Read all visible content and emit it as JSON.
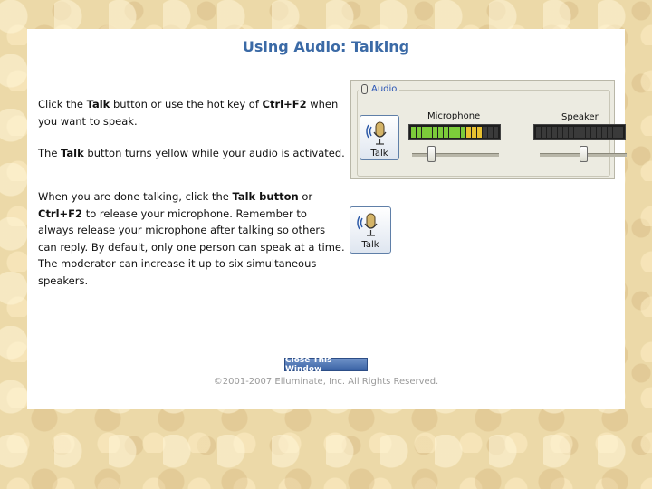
{
  "title": "Using Audio: Talking",
  "para1": {
    "t1": "Click the ",
    "b1": "Talk",
    "t2": " button or use the hot key of ",
    "b2": "Ctrl+F2",
    "t3": " when you want to speak."
  },
  "para2": {
    "t1": "The ",
    "b1": "Talk",
    "t2": " button turns yellow while your audio is activated."
  },
  "para3": {
    "t1": "When you are done talking, click the ",
    "b1": "Talk button",
    "t2": " or ",
    "b2": "Ctrl+F2",
    "t3": " to release your microphone. Remember to always release your microphone after talking so others can reply. By default, only one person can speak at a time. The moderator can increase it up to six simultaneous speakers."
  },
  "audio_panel": {
    "legend": "Audio",
    "talk_label": "Talk",
    "microphone_label": "Microphone",
    "speaker_label": "Speaker",
    "microphone_level": 0.8,
    "speaker_level": 0.0,
    "microphone_slider": 0.2,
    "speaker_slider": 0.5
  },
  "talk_button": {
    "label": "Talk"
  },
  "close_button": {
    "label": "Close This Window"
  },
  "copyright": "©2001-2007 Elluminate, Inc. All Rights Reserved.",
  "colors": {
    "title": "#3b6aa6",
    "meter_green": "#7ccc3a",
    "meter_yellow": "#e9c231"
  }
}
